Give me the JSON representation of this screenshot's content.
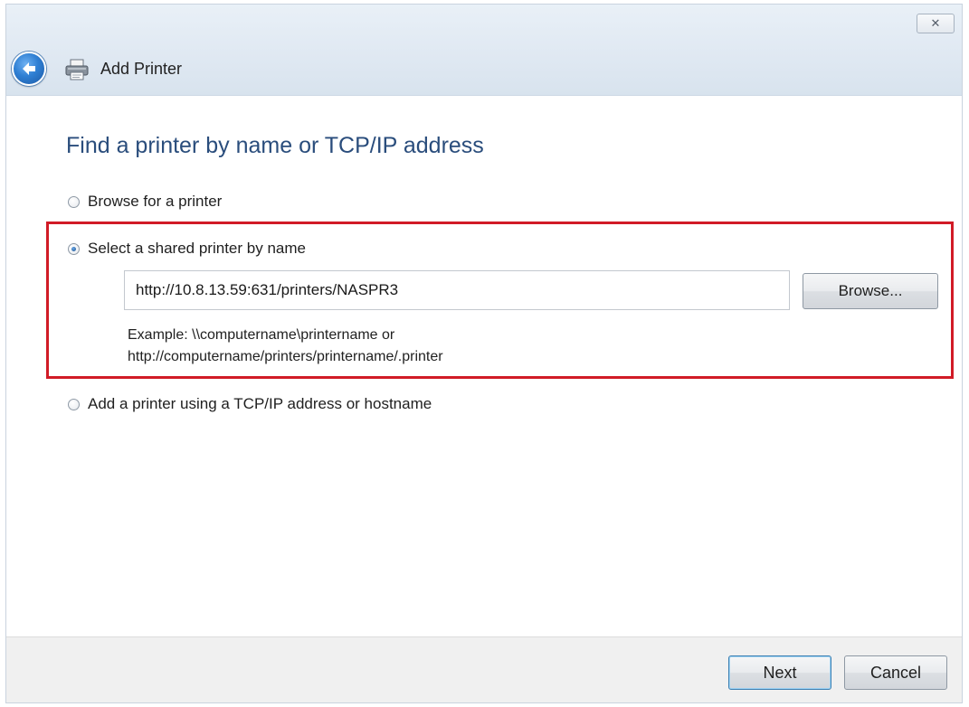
{
  "window": {
    "title": "Add Printer",
    "close_glyph": "✕"
  },
  "icons": {
    "back": "back-arrow-icon",
    "printer": "printer-icon",
    "close": "close-icon"
  },
  "main": {
    "heading": "Find a printer by name or TCP/IP address",
    "options": [
      {
        "label": "Browse for a printer",
        "checked": false
      },
      {
        "label": "Select a shared printer by name",
        "checked": true
      },
      {
        "label": "Add a printer using a TCP/IP address or hostname",
        "checked": false
      }
    ],
    "shared_printer_input": {
      "value": "http://10.8.13.59:631/printers/NASPR3"
    },
    "browse_label": "Browse...",
    "example_line1": "Example: \\\\computername\\printername or",
    "example_line2": "http://computername/printers/printername/.printer"
  },
  "footer": {
    "next_label": "Next",
    "cancel_label": "Cancel"
  },
  "colors": {
    "highlight_border": "#d11b26",
    "heading": "#2a4d7c",
    "back_button": "#2f7fd3"
  }
}
